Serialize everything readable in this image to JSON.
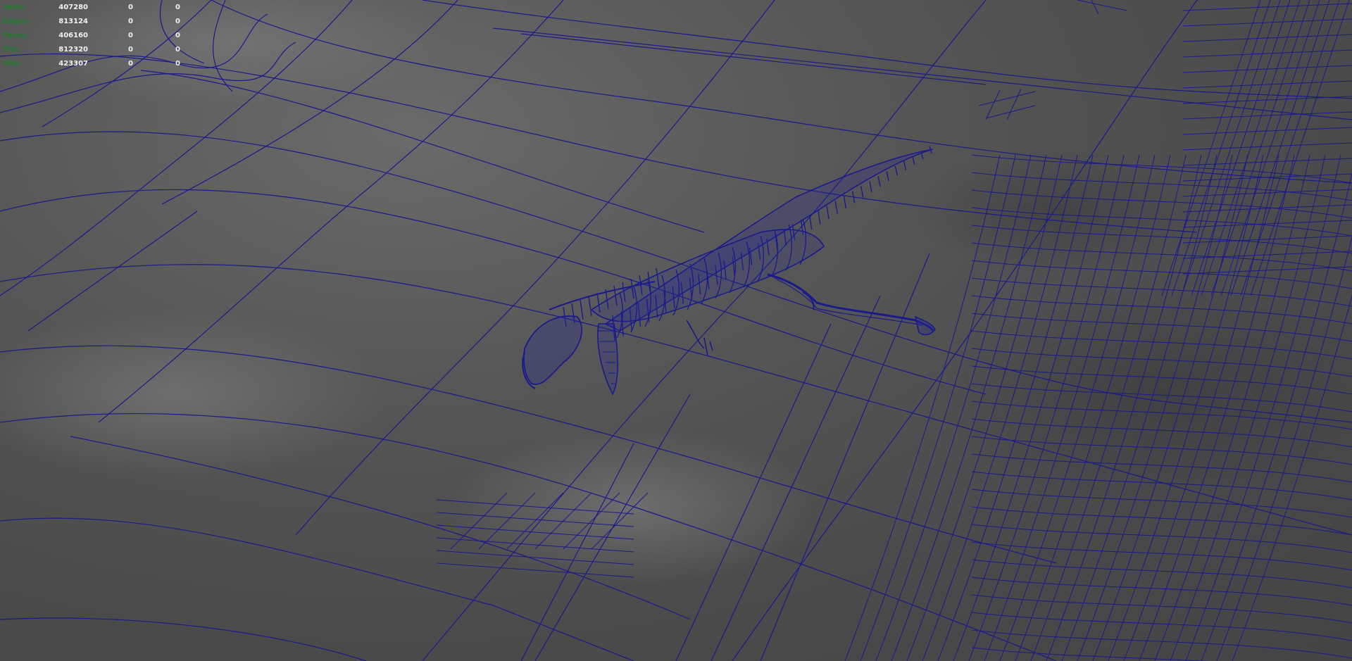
{
  "hud": {
    "rows": [
      {
        "label": "Verts:",
        "total": "407280",
        "selected": "0",
        "tris_sel": "0"
      },
      {
        "label": "Edges:",
        "total": "813124",
        "selected": "0",
        "tris_sel": "0"
      },
      {
        "label": "Faces:",
        "total": "406160",
        "selected": "0",
        "tris_sel": "0"
      },
      {
        "label": "Tris:",
        "total": "812320",
        "selected": "0",
        "tris_sel": "0"
      },
      {
        "label": "UVs:",
        "total": "423307",
        "selected": "0",
        "tris_sel": "0"
      }
    ]
  },
  "colors": {
    "wireframe": "#1a1a8c",
    "hud_label": "#1e7a2c",
    "hud_value": "#f0f0f0",
    "viewport_bg": "#4a4a4a"
  }
}
